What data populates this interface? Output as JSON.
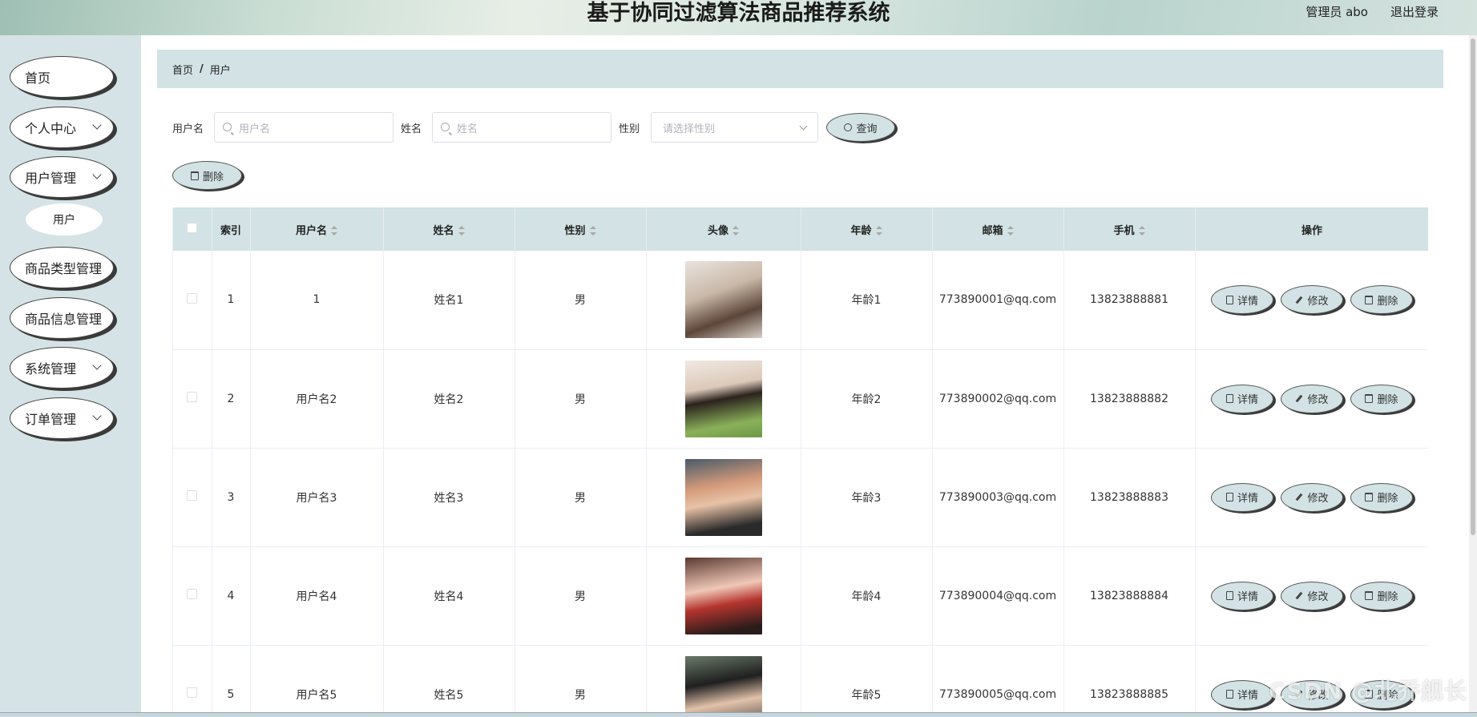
{
  "header": {
    "title": "基于协同过滤算法商品推荐系统",
    "user": "管理员 abo",
    "logout": "退出登录"
  },
  "sidebar": {
    "items": [
      {
        "label": "首页",
        "has_children": false
      },
      {
        "label": "个人中心",
        "has_children": true
      },
      {
        "label": "用户管理",
        "has_children": true
      },
      {
        "label": "商品类型管理",
        "has_children": false
      },
      {
        "label": "商品信息管理",
        "has_children": false
      },
      {
        "label": "系统管理",
        "has_children": true
      },
      {
        "label": "订单管理",
        "has_children": true
      }
    ],
    "subitem": "用户"
  },
  "breadcrumb": {
    "home": "首页",
    "separator": "/",
    "current": "用户"
  },
  "filters": {
    "username_label": "用户名",
    "username_placeholder": "用户名",
    "name_label": "姓名",
    "name_placeholder": "姓名",
    "gender_label": "性别",
    "gender_placeholder": "请选择性别",
    "search_button": "查询"
  },
  "actions": {
    "delete_button": "删除"
  },
  "table": {
    "columns": [
      "索引",
      "用户名",
      "姓名",
      "性别",
      "头像",
      "年龄",
      "邮箱",
      "手机",
      "操作"
    ],
    "row_actions": {
      "detail": "详情",
      "edit": "修改",
      "delete": "删除"
    },
    "rows": [
      {
        "index": "1",
        "username": "1",
        "name": "姓名1",
        "gender": "男",
        "age": "年龄1",
        "email": "773890001@qq.com",
        "phone": "13823888881"
      },
      {
        "index": "2",
        "username": "用户名2",
        "name": "姓名2",
        "gender": "男",
        "age": "年龄2",
        "email": "773890002@qq.com",
        "phone": "13823888882"
      },
      {
        "index": "3",
        "username": "用户名3",
        "name": "姓名3",
        "gender": "男",
        "age": "年龄3",
        "email": "773890003@qq.com",
        "phone": "13823888883"
      },
      {
        "index": "4",
        "username": "用户名4",
        "name": "姓名4",
        "gender": "男",
        "age": "年龄4",
        "email": "773890004@qq.com",
        "phone": "13823888884"
      },
      {
        "index": "5",
        "username": "用户名5",
        "name": "姓名5",
        "gender": "男",
        "age": "年龄5",
        "email": "773890005@qq.com",
        "phone": "13823888885"
      }
    ]
  },
  "watermark": "CSDN @北乔舰长",
  "colors": {
    "accent": "#d2e2e5",
    "sidebar_bg": "#d5e3e7"
  }
}
